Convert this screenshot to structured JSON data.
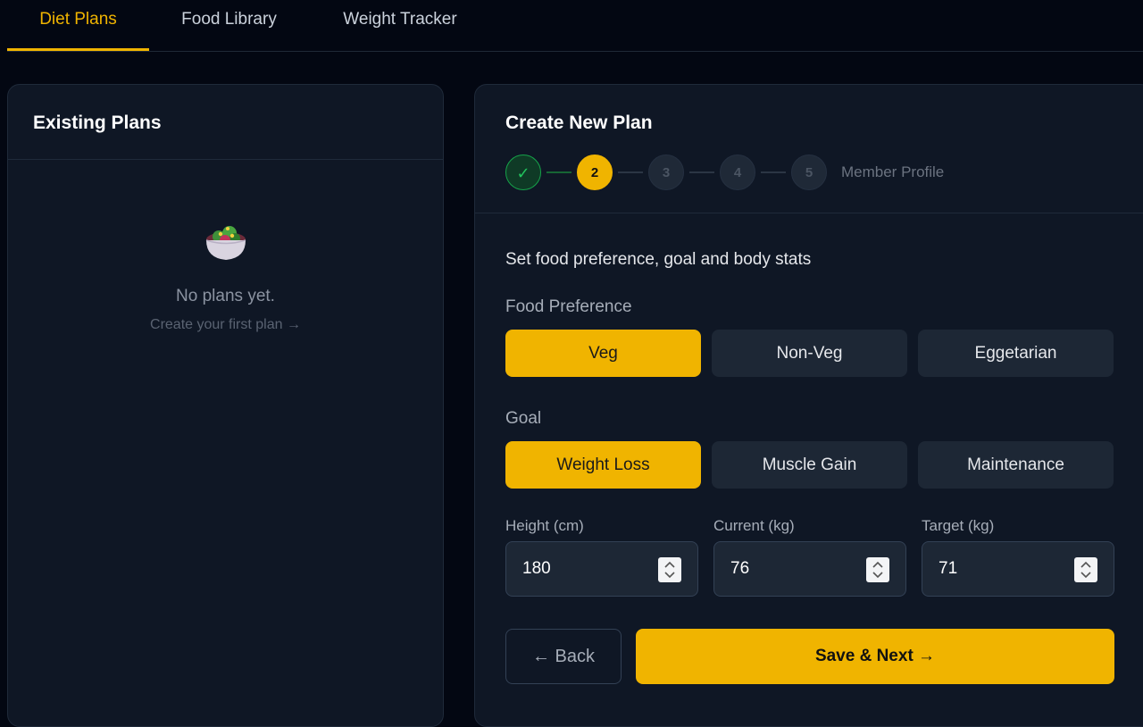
{
  "tabs": [
    {
      "label": "Diet Plans",
      "active": true
    },
    {
      "label": "Food Library",
      "active": false
    },
    {
      "label": "Weight Tracker",
      "active": false
    }
  ],
  "existing": {
    "title": "Existing Plans",
    "empty_icon": "salad-bowl-icon",
    "empty_title": "No plans yet.",
    "empty_sub": "Create your first plan →"
  },
  "create": {
    "title": "Create New Plan",
    "steps": [
      "✓",
      "2",
      "3",
      "4",
      "5"
    ],
    "current_step": 2,
    "step_label": "Member Profile",
    "subtitle": "Set food preference, goal and body stats",
    "food_pref": {
      "label": "Food Preference",
      "options": [
        "Veg",
        "Non-Veg",
        "Eggetarian"
      ],
      "selected": "Veg"
    },
    "goal": {
      "label": "Goal",
      "options": [
        "Weight Loss",
        "Muscle Gain",
        "Maintenance"
      ],
      "selected": "Weight Loss"
    },
    "fields": [
      {
        "label": "Height (cm)",
        "value": "180"
      },
      {
        "label": "Current (kg)",
        "value": "76"
      },
      {
        "label": "Target (kg)",
        "value": "71"
      }
    ],
    "back_label": "← Back",
    "next_label": "Save & Next →"
  },
  "colors": {
    "accent": "#f0b400",
    "background": "#030712",
    "panel": "#0f1725",
    "success": "#22c55e"
  }
}
